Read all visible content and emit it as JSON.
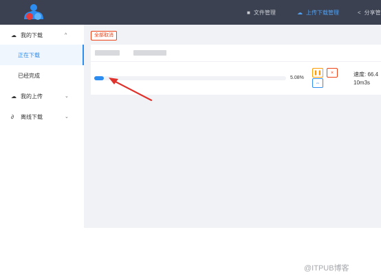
{
  "header": {
    "nav": [
      {
        "label": "文件管理",
        "icon": "folder-icon",
        "active": false
      },
      {
        "label": "上传下载管理",
        "icon": "cloud-icon",
        "active": true
      },
      {
        "label": "分享管",
        "icon": "share-icon",
        "active": false
      }
    ]
  },
  "sidebar": {
    "groups": [
      {
        "label": "我的下载",
        "icon": "cloud-icon",
        "expanded": true,
        "items": [
          {
            "label": "正在下载",
            "active": true
          },
          {
            "label": "已经完成",
            "active": false
          }
        ]
      },
      {
        "label": "我的上传",
        "icon": "cloud-icon",
        "expanded": false
      },
      {
        "label": "离线下载",
        "icon": "link-icon",
        "expanded": false
      }
    ]
  },
  "main": {
    "cancel_all_label": "全部取消",
    "task": {
      "progress": 5.08,
      "progress_label": "5.08%",
      "speed_label": "速度: 66.4",
      "remaining_label": "10m3s",
      "actions": [
        "pause-icon",
        "close-icon",
        "resume-icon"
      ]
    }
  },
  "watermark": "@ITPUB博客",
  "colors": {
    "header_bg": "#3b4150",
    "accent": "#2d8cf0",
    "warning": "#ff9900",
    "danger": "#ed4014",
    "annotation_arrow": "#e0322c"
  }
}
